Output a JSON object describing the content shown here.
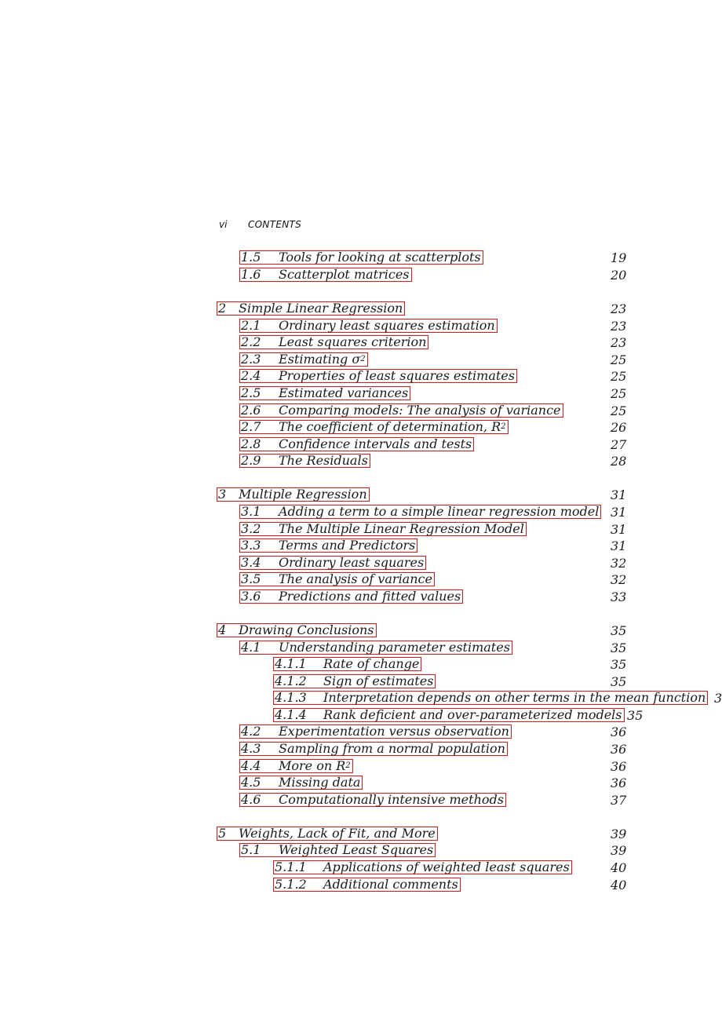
{
  "running_head": {
    "folio": "vi",
    "title": "CONTENTS"
  },
  "link_box_color": "#ee1111",
  "entries": [
    {
      "level": 2,
      "num": "1.5",
      "title": "Tools for looking at scatterplots",
      "page": "19"
    },
    {
      "level": 2,
      "num": "1.6",
      "title": "Scatterplot matrices",
      "page": "20"
    },
    {
      "level": 1,
      "num": "2",
      "title": "Simple Linear Regression",
      "page": "23"
    },
    {
      "level": 2,
      "num": "2.1",
      "title": "Ordinary least squares estimation",
      "page": "23"
    },
    {
      "level": 2,
      "num": "2.2",
      "title": "Least squares criterion",
      "page": "23"
    },
    {
      "level": 2,
      "num": "2.3",
      "title": "Estimating σ",
      "sup": "2",
      "page": "25"
    },
    {
      "level": 2,
      "num": "2.4",
      "title": "Properties of least squares estimates",
      "page": "25"
    },
    {
      "level": 2,
      "num": "2.5",
      "title": "Estimated variances",
      "page": "25"
    },
    {
      "level": 2,
      "num": "2.6",
      "title": "Comparing models: The analysis of variance",
      "page": "25"
    },
    {
      "level": 2,
      "num": "2.7",
      "title": "The coefficient of determination, R",
      "sup": "2",
      "page": "26"
    },
    {
      "level": 2,
      "num": "2.8",
      "title": "Confidence intervals and tests",
      "page": "27"
    },
    {
      "level": 2,
      "num": "2.9",
      "title": "The Residuals",
      "page": "28"
    },
    {
      "level": 1,
      "num": "3",
      "title": "Multiple Regression",
      "page": "31"
    },
    {
      "level": 2,
      "num": "3.1",
      "title": "Adding a term to a simple linear regression model",
      "page": "31"
    },
    {
      "level": 2,
      "num": "3.2",
      "title": "The Multiple Linear Regression Model",
      "page": "31"
    },
    {
      "level": 2,
      "num": "3.3",
      "title": "Terms and Predictors",
      "page": "31"
    },
    {
      "level": 2,
      "num": "3.4",
      "title": "Ordinary least squares",
      "page": "32"
    },
    {
      "level": 2,
      "num": "3.5",
      "title": "The analysis of variance",
      "page": "32"
    },
    {
      "level": 2,
      "num": "3.6",
      "title": "Predictions and fitted values",
      "page": "33"
    },
    {
      "level": 1,
      "num": "4",
      "title": "Drawing Conclusions",
      "page": "35"
    },
    {
      "level": 2,
      "num": "4.1",
      "title": "Understanding parameter estimates",
      "page": "35"
    },
    {
      "level": 3,
      "num": "4.1.1",
      "title": "Rate of change",
      "page": "35"
    },
    {
      "level": 3,
      "num": "4.1.2",
      "title": "Sign of estimates",
      "page": "35"
    },
    {
      "level": 3,
      "num": "4.1.3",
      "title": "Interpretation depends on other terms in the mean function",
      "page": "3"
    },
    {
      "level": 3,
      "num": "4.1.4",
      "title": "Rank deficient and over-parameterized models",
      "page": "35"
    },
    {
      "level": 2,
      "num": "4.2",
      "title": "Experimentation versus observation",
      "page": "36"
    },
    {
      "level": 2,
      "num": "4.3",
      "title": "Sampling from a normal population",
      "page": "36"
    },
    {
      "level": 2,
      "num": "4.4",
      "title": "More on R",
      "sup": "2",
      "page": "36"
    },
    {
      "level": 2,
      "num": "4.5",
      "title": "Missing data",
      "page": "36"
    },
    {
      "level": 2,
      "num": "4.6",
      "title": "Computationally intensive methods",
      "page": "37"
    },
    {
      "level": 1,
      "num": "5",
      "title": "Weights, Lack of Fit, and More",
      "page": "39"
    },
    {
      "level": 2,
      "num": "5.1",
      "title": "Weighted Least Squares",
      "page": "39"
    },
    {
      "level": 3,
      "num": "5.1.1",
      "title": "Applications of weighted least squares",
      "page": "40"
    },
    {
      "level": 3,
      "num": "5.1.2",
      "title": "Additional comments",
      "page": "40"
    }
  ]
}
